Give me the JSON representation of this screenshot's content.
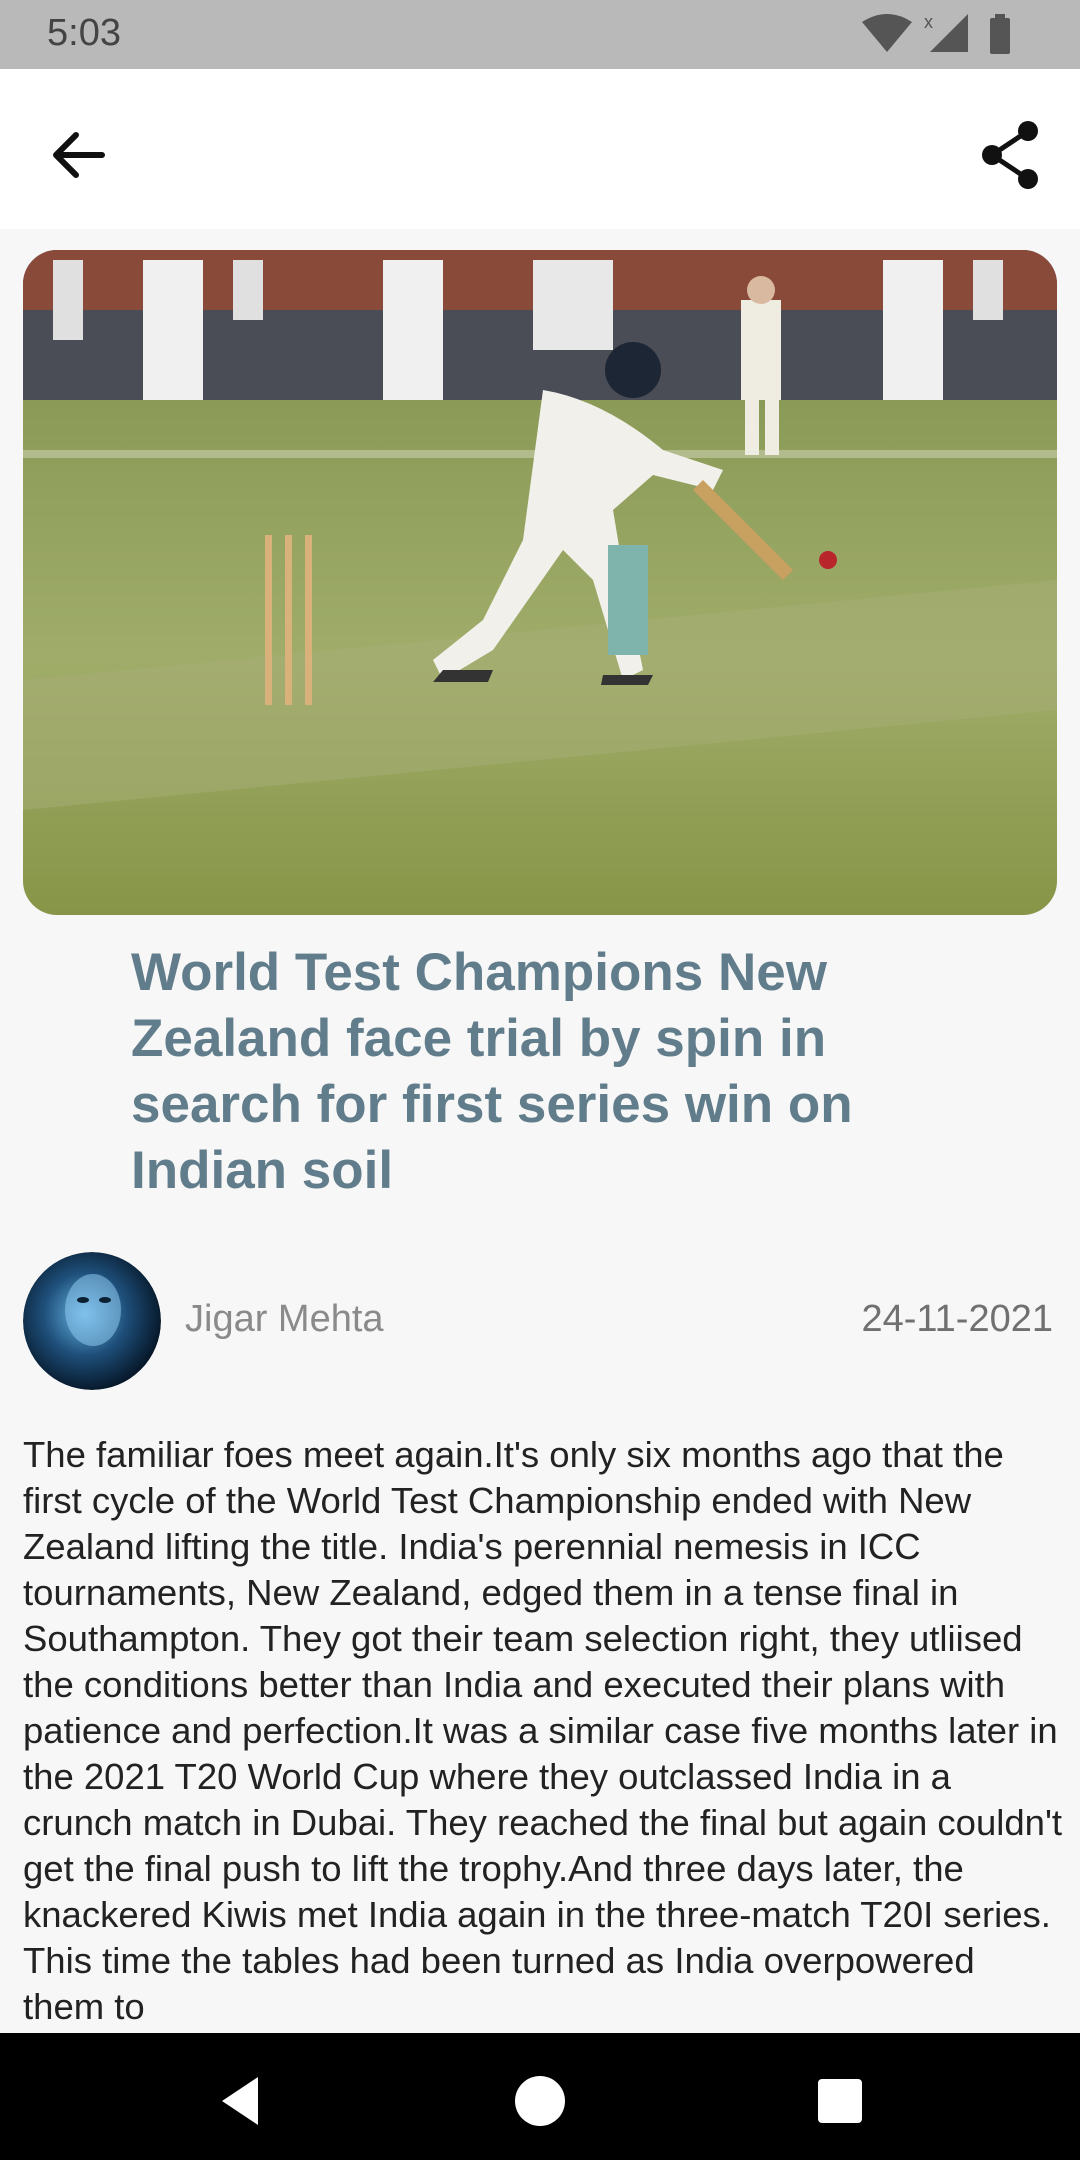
{
  "status_bar": {
    "time": "5:03",
    "icons": [
      "wifi-icon",
      "signal-icon",
      "battery-icon"
    ]
  },
  "app_bar": {
    "back_icon": "arrow-left-icon",
    "share_icon": "share-icon"
  },
  "article": {
    "headline": "World Test Champions New Zealand face trial by spin in search for first series win on Indian soil",
    "author": "Jigar Mehta",
    "date": "24-11-2021",
    "body": "The familiar foes meet again.It's only six months ago that the first cycle of the World Test Championship ended with New Zealand lifting the title. India's perennial nemesis in ICC tournaments, New Zealand, edged them in a tense final in Southampton. They got their team selection right, they utliised the conditions better than India and executed their plans with patience and perfection.It was a similar case five months later in the 2021 T20 World Cup where they outclassed India in a crunch match in Dubai. They reached the final but again couldn't get the final push to lift the trophy.And three days later, the knackered Kiwis met India again in the three-match T20I series. This time the tables had been turned as India overpowered them to"
  },
  "colors": {
    "headline": "#617d8b",
    "status_bar": "#b9b9b9",
    "nav_bar": "#000000"
  },
  "nav": {
    "icons": [
      "back-triangle-icon",
      "home-circle-icon",
      "recents-square-icon"
    ]
  }
}
